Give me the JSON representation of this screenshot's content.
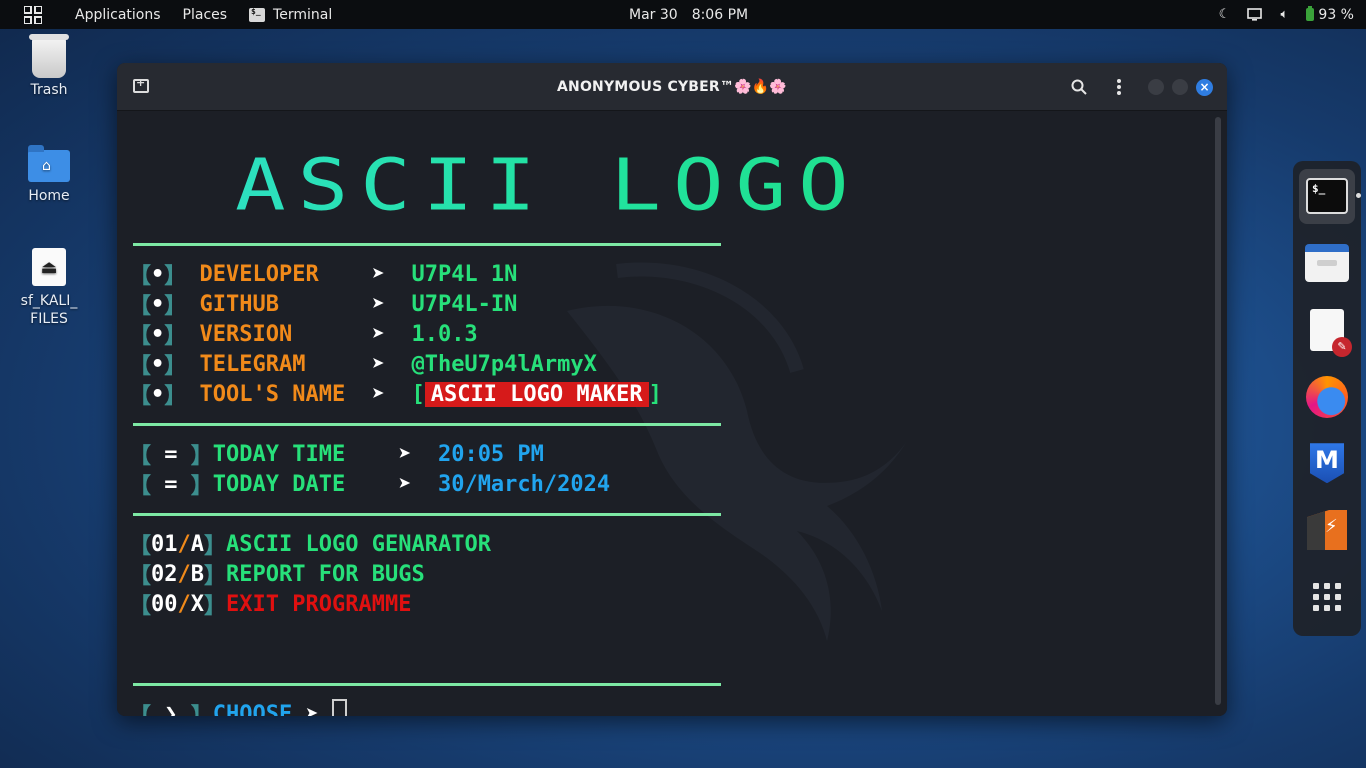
{
  "topbar": {
    "applications": "Applications",
    "places": "Places",
    "terminal": "Terminal",
    "date": "Mar 30",
    "time": "8:06 PM",
    "battery": "93 %"
  },
  "desktop": {
    "trash": "Trash",
    "home": "Home",
    "drive": "sf_KALI_\nFILES"
  },
  "window": {
    "title": "ANONYMOUS CYBER™🌸🔥🌸"
  },
  "terminal": {
    "logo": "ASCII LOGO",
    "info": [
      {
        "bullet": "•",
        "label": "DEVELOPER   ",
        "value": "U7P4L 1N"
      },
      {
        "bullet": "•",
        "label": "GITHUB      ",
        "value": "U7P4L-IN"
      },
      {
        "bullet": "•",
        "label": "VERSION     ",
        "value": "1.0.3"
      },
      {
        "bullet": "•",
        "label": "TELEGRAM    ",
        "value": "@TheU7p4lArmyX"
      },
      {
        "bullet": "•",
        "label": "TOOL'S NAME ",
        "value": "ASCII LOGO MAKER"
      }
    ],
    "time_label": "TODAY TIME   ",
    "time_value": "20:05 PM",
    "date_label": "TODAY DATE   ",
    "date_value": "30/March/2024",
    "menu": [
      {
        "num": "01",
        "key": "A",
        "label": "ASCII LOGO GENARATOR"
      },
      {
        "num": "02",
        "key": "B",
        "label": "REPORT FOR BUGS"
      },
      {
        "num": "00",
        "key": "X",
        "label": "EXIT PROGRAMME"
      }
    ],
    "prompt_label": "CHOOSE"
  },
  "dock": [
    "terminal-emulator",
    "file-manager",
    "text-editor",
    "firefox",
    "metasploit",
    "burp-suite",
    "show-applications"
  ]
}
